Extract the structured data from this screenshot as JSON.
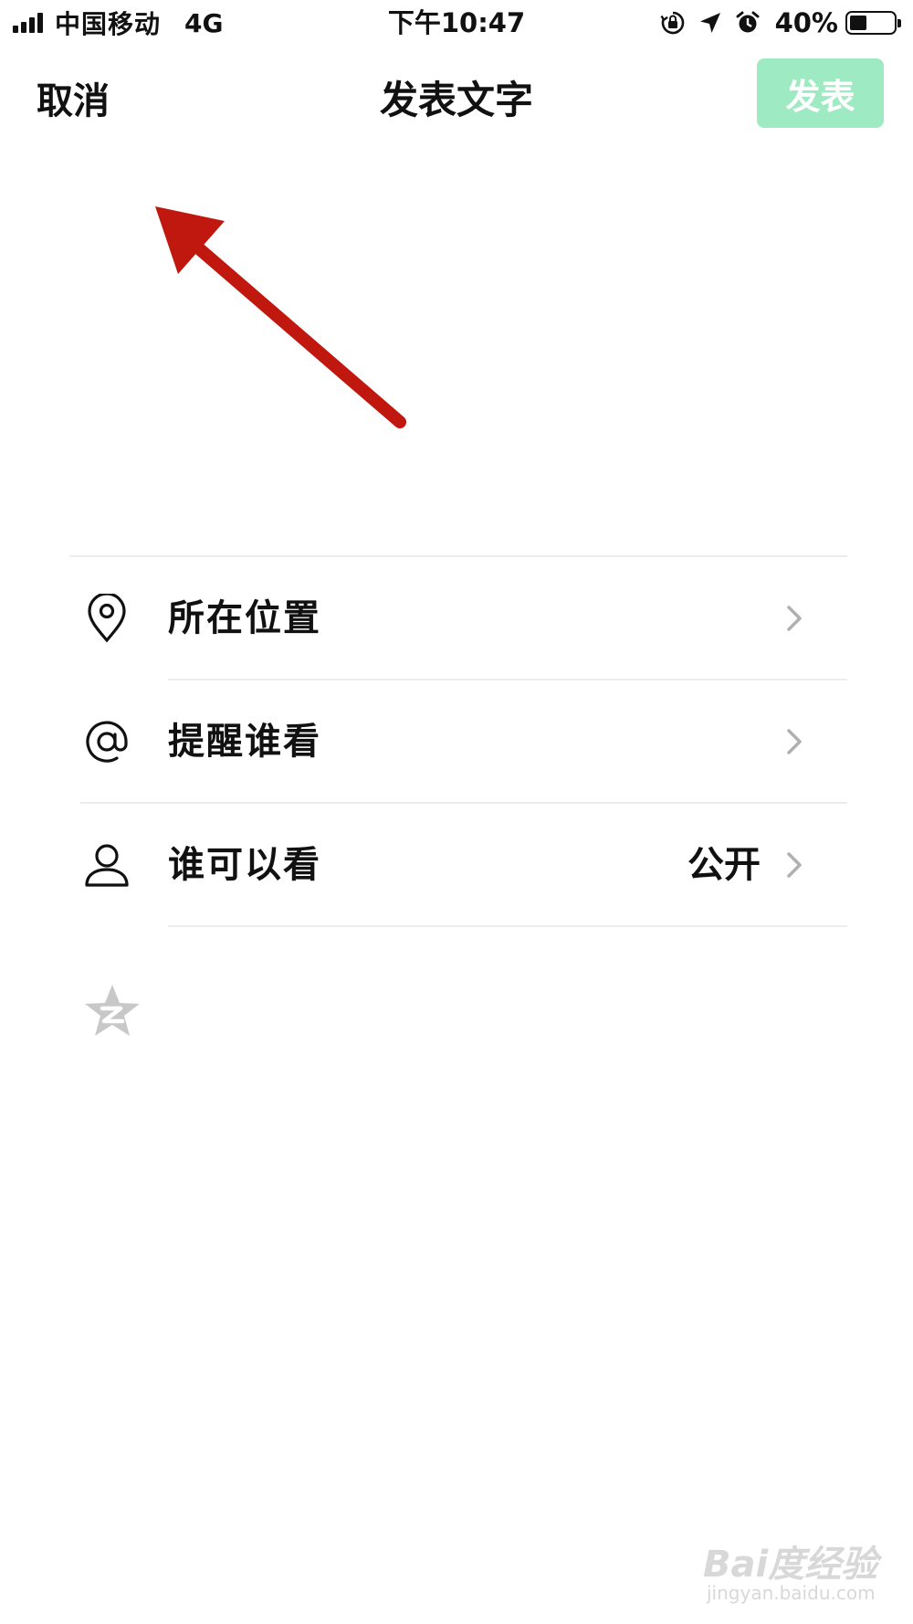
{
  "status_bar": {
    "carrier": "中国移动",
    "network": "4G",
    "time": "下午10:47",
    "battery_percent": "40%",
    "battery_level": 0.4,
    "icons": [
      "orientation-lock-icon",
      "location-arrow-icon",
      "alarm-icon"
    ]
  },
  "nav": {
    "cancel_label": "取消",
    "title": "发表文字",
    "publish_label": "发表",
    "publish_color": "#9eebc3"
  },
  "compose": {
    "placeholder": ""
  },
  "options": [
    {
      "icon": "location-pin-icon",
      "label": "所在位置",
      "value": ""
    },
    {
      "icon": "at-sign-icon",
      "label": "提醒谁看",
      "value": ""
    },
    {
      "icon": "person-icon",
      "label": "谁可以看",
      "value": "公开"
    }
  ],
  "share_icon": "qzone-icon",
  "annotation": {
    "arrow_color": "#c0180f"
  },
  "watermark": {
    "main": "Bai度经验",
    "sub": "jingyan.baidu.com"
  }
}
